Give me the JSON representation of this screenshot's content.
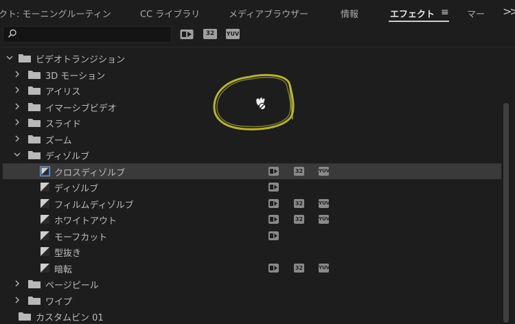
{
  "tabs": [
    {
      "label": "クト: モーニングルーティン",
      "active": false
    },
    {
      "label": "CC ライブラリ",
      "active": false
    },
    {
      "label": "メディアブラウザー",
      "active": false
    },
    {
      "label": "情報",
      "active": false
    },
    {
      "label": "エフェクト",
      "active": true
    },
    {
      "label": "マー",
      "active": false
    }
  ],
  "menu_icon": "hamburger-icon",
  "overflow_icon": "double-chevron-right-icon",
  "search": {
    "value": "",
    "placeholder": "",
    "icon": "search-icon"
  },
  "badges": {
    "accel": "accelerated-icon",
    "bit32": "32",
    "yuv": "YUV"
  },
  "tree": [
    {
      "label": "ビデオトランジション",
      "type": "folder",
      "expanded": true,
      "depth": 0
    },
    {
      "label": "3D モーション",
      "type": "folder",
      "expanded": false,
      "depth": 1
    },
    {
      "label": "アイリス",
      "type": "folder",
      "expanded": false,
      "depth": 1
    },
    {
      "label": "イマーシブビデオ",
      "type": "folder",
      "expanded": false,
      "depth": 1
    },
    {
      "label": "スライド",
      "type": "folder",
      "expanded": false,
      "depth": 1
    },
    {
      "label": "ズーム",
      "type": "folder",
      "expanded": false,
      "depth": 1
    },
    {
      "label": "ディゾルブ",
      "type": "folder",
      "expanded": true,
      "depth": 1
    },
    {
      "label": "クロスディゾルブ",
      "type": "effect",
      "selected": true,
      "accel": true,
      "bit32": true,
      "yuv": true
    },
    {
      "label": "ディゾルブ",
      "type": "effect",
      "accel": true,
      "bit32": false,
      "yuv": false
    },
    {
      "label": "フィルムディゾルブ",
      "type": "effect",
      "accel": true,
      "bit32": true,
      "yuv": true
    },
    {
      "label": "ホワイトアウト",
      "type": "effect",
      "accel": true,
      "bit32": true,
      "yuv": true
    },
    {
      "label": "モーフカット",
      "type": "effect",
      "accel": true,
      "bit32": false,
      "yuv": false
    },
    {
      "label": "型抜き",
      "type": "effect",
      "accel": false,
      "bit32": false,
      "yuv": false
    },
    {
      "label": "暗転",
      "type": "effect",
      "accel": true,
      "bit32": true,
      "yuv": true
    },
    {
      "label": "ページピール",
      "type": "folder",
      "expanded": false,
      "depth": 1
    },
    {
      "label": "ワイプ",
      "type": "folder",
      "expanded": false,
      "depth": 1
    },
    {
      "label": "カスタムビン 01",
      "type": "folder",
      "expanded": false,
      "depth": 0,
      "no_chevron": true
    }
  ],
  "colors": {
    "background": "#1d1d1d",
    "selected_row": "#3a3a3a",
    "annotation": "#c9c23a",
    "text": "#bdbdbd"
  }
}
